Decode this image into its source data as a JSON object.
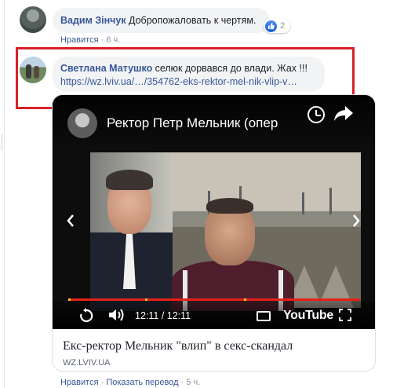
{
  "comment1": {
    "author": "Вадим Зінчук",
    "text": "Добропожаловать к чертям.",
    "reaction_count": "2",
    "like_action": "Нравится",
    "separator": "·",
    "time": "6 ч."
  },
  "comment2": {
    "author": "Светлана Матушко",
    "text": "селюк дорвався до влади. Жах !!!",
    "link": "https://wz.lviv.ua/…/354762-eks-rektor-mel-nik-vlip-v…"
  },
  "video": {
    "title": "Ректор Петр Мельник (опер",
    "time": "12:11 / 12:11",
    "logo": "YouTube",
    "progress": 1.0
  },
  "card": {
    "title": "Екс-ректор Мельник \"влип\" в секс-скандал",
    "domain": "WZ.LVIV.UA"
  },
  "footer": {
    "like_action": "Нравится",
    "separator": "·",
    "translate_action": "Показать перевод",
    "time": "5 ч."
  },
  "colors": {
    "link": "#385898",
    "highlight": "#d9212a",
    "progress": "#e62117"
  },
  "icons": [
    "like-icon",
    "clock-icon",
    "share-icon",
    "replay-icon",
    "volume-icon",
    "cc-icon",
    "fullscreen-icon",
    "chevron-left-icon",
    "chevron-right-icon"
  ]
}
